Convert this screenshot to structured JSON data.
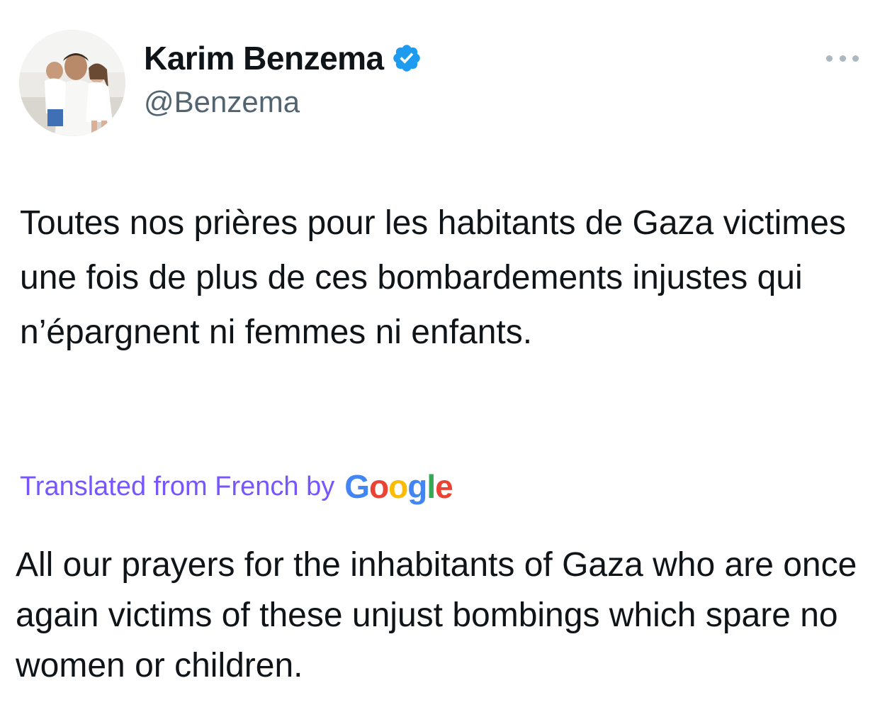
{
  "author": {
    "display_name": "Karim Benzema",
    "handle": "@Benzema",
    "avatar_icon": "profile-photo",
    "verified_icon": "verified-badge-icon",
    "verified_color": "#1d9bf0"
  },
  "more_icon": "more-options-icon",
  "tweet": {
    "text": "Toutes nos prières pour les habitants de Gaza victimes une fois de plus de ces bombardements injustes qui n’épargnent ni femmes ni enfants."
  },
  "translation": {
    "label": "Translated from French by",
    "provider_letters": [
      "G",
      "o",
      "o",
      "g",
      "l",
      "e"
    ],
    "label_color": "#7856ff",
    "text": "All our prayers for the inhabitants of Gaza who are once again victims of these unjust bombings which spare no women or children."
  }
}
